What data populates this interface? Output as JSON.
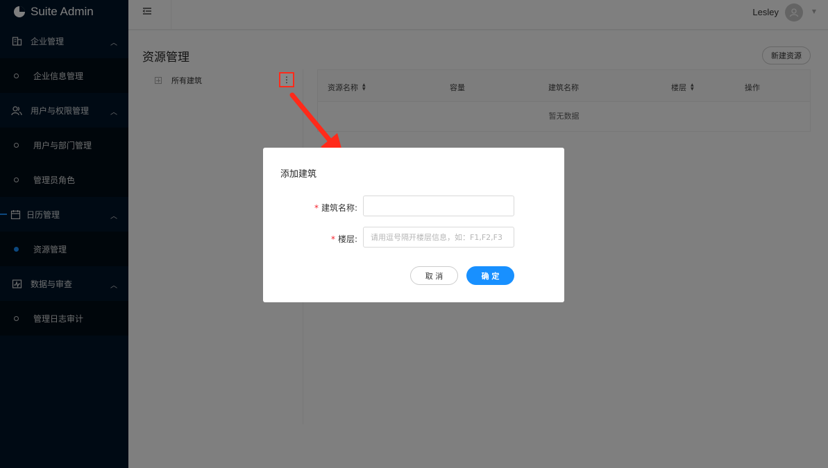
{
  "app": {
    "title": "Suite Admin"
  },
  "sidebar": {
    "groups": [
      {
        "label": "企业管理",
        "icon": "building-icon",
        "items": [
          {
            "label": "企业信息管理"
          }
        ]
      },
      {
        "label": "用户与权限管理",
        "icon": "users-icon",
        "items": [
          {
            "label": "用户与部门管理"
          },
          {
            "label": "管理员角色"
          }
        ]
      },
      {
        "label": "日历管理",
        "icon": "calendar-icon",
        "items": [
          {
            "label": "资源管理",
            "selected": true
          }
        ]
      },
      {
        "label": "数据与审查",
        "icon": "chart-icon",
        "items": [
          {
            "label": "管理日志审计"
          }
        ]
      }
    ]
  },
  "header": {
    "user": "Lesley"
  },
  "page": {
    "title": "资源管理",
    "new_button": "新建资源",
    "tree_root": "所有建筑",
    "more_icon": "⋮"
  },
  "table": {
    "columns": [
      "资源名称",
      "容量",
      "建筑名称",
      "楼层",
      "操作"
    ],
    "empty_text": "暂无数据"
  },
  "modal": {
    "title": "添加建筑",
    "fields": [
      {
        "label": "建筑名称:",
        "required": true,
        "value": "",
        "placeholder": ""
      },
      {
        "label": "楼层:",
        "required": true,
        "value": "",
        "placeholder": "请用逗号隔开楼层信息，如：F1,F2,F3"
      }
    ],
    "cancel_label": "取 消",
    "ok_label": "确 定"
  },
  "colors": {
    "primary": "#1890ff",
    "sidebar": "#001529",
    "annotation": "#ff2a1a"
  }
}
